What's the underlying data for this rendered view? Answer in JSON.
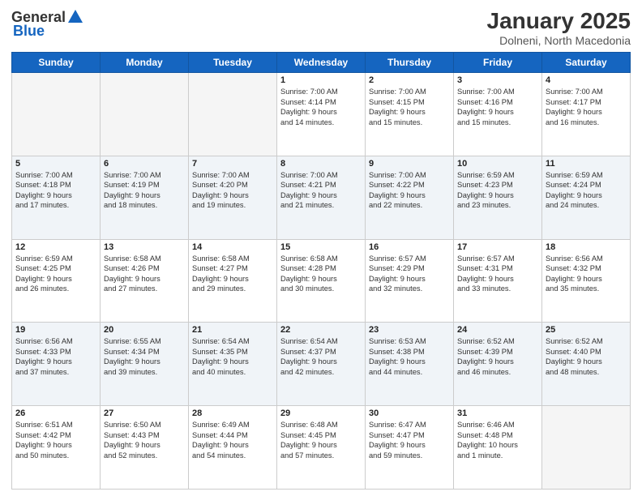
{
  "header": {
    "logo_general": "General",
    "logo_blue": "Blue",
    "month_year": "January 2025",
    "location": "Dolneni, North Macedonia"
  },
  "days_of_week": [
    "Sunday",
    "Monday",
    "Tuesday",
    "Wednesday",
    "Thursday",
    "Friday",
    "Saturday"
  ],
  "weeks": [
    {
      "shaded": false,
      "days": [
        {
          "num": "",
          "info": ""
        },
        {
          "num": "",
          "info": ""
        },
        {
          "num": "",
          "info": ""
        },
        {
          "num": "1",
          "info": "Sunrise: 7:00 AM\nSunset: 4:14 PM\nDaylight: 9 hours\nand 14 minutes."
        },
        {
          "num": "2",
          "info": "Sunrise: 7:00 AM\nSunset: 4:15 PM\nDaylight: 9 hours\nand 15 minutes."
        },
        {
          "num": "3",
          "info": "Sunrise: 7:00 AM\nSunset: 4:16 PM\nDaylight: 9 hours\nand 15 minutes."
        },
        {
          "num": "4",
          "info": "Sunrise: 7:00 AM\nSunset: 4:17 PM\nDaylight: 9 hours\nand 16 minutes."
        }
      ]
    },
    {
      "shaded": true,
      "days": [
        {
          "num": "5",
          "info": "Sunrise: 7:00 AM\nSunset: 4:18 PM\nDaylight: 9 hours\nand 17 minutes."
        },
        {
          "num": "6",
          "info": "Sunrise: 7:00 AM\nSunset: 4:19 PM\nDaylight: 9 hours\nand 18 minutes."
        },
        {
          "num": "7",
          "info": "Sunrise: 7:00 AM\nSunset: 4:20 PM\nDaylight: 9 hours\nand 19 minutes."
        },
        {
          "num": "8",
          "info": "Sunrise: 7:00 AM\nSunset: 4:21 PM\nDaylight: 9 hours\nand 21 minutes."
        },
        {
          "num": "9",
          "info": "Sunrise: 7:00 AM\nSunset: 4:22 PM\nDaylight: 9 hours\nand 22 minutes."
        },
        {
          "num": "10",
          "info": "Sunrise: 6:59 AM\nSunset: 4:23 PM\nDaylight: 9 hours\nand 23 minutes."
        },
        {
          "num": "11",
          "info": "Sunrise: 6:59 AM\nSunset: 4:24 PM\nDaylight: 9 hours\nand 24 minutes."
        }
      ]
    },
    {
      "shaded": false,
      "days": [
        {
          "num": "12",
          "info": "Sunrise: 6:59 AM\nSunset: 4:25 PM\nDaylight: 9 hours\nand 26 minutes."
        },
        {
          "num": "13",
          "info": "Sunrise: 6:58 AM\nSunset: 4:26 PM\nDaylight: 9 hours\nand 27 minutes."
        },
        {
          "num": "14",
          "info": "Sunrise: 6:58 AM\nSunset: 4:27 PM\nDaylight: 9 hours\nand 29 minutes."
        },
        {
          "num": "15",
          "info": "Sunrise: 6:58 AM\nSunset: 4:28 PM\nDaylight: 9 hours\nand 30 minutes."
        },
        {
          "num": "16",
          "info": "Sunrise: 6:57 AM\nSunset: 4:29 PM\nDaylight: 9 hours\nand 32 minutes."
        },
        {
          "num": "17",
          "info": "Sunrise: 6:57 AM\nSunset: 4:31 PM\nDaylight: 9 hours\nand 33 minutes."
        },
        {
          "num": "18",
          "info": "Sunrise: 6:56 AM\nSunset: 4:32 PM\nDaylight: 9 hours\nand 35 minutes."
        }
      ]
    },
    {
      "shaded": true,
      "days": [
        {
          "num": "19",
          "info": "Sunrise: 6:56 AM\nSunset: 4:33 PM\nDaylight: 9 hours\nand 37 minutes."
        },
        {
          "num": "20",
          "info": "Sunrise: 6:55 AM\nSunset: 4:34 PM\nDaylight: 9 hours\nand 39 minutes."
        },
        {
          "num": "21",
          "info": "Sunrise: 6:54 AM\nSunset: 4:35 PM\nDaylight: 9 hours\nand 40 minutes."
        },
        {
          "num": "22",
          "info": "Sunrise: 6:54 AM\nSunset: 4:37 PM\nDaylight: 9 hours\nand 42 minutes."
        },
        {
          "num": "23",
          "info": "Sunrise: 6:53 AM\nSunset: 4:38 PM\nDaylight: 9 hours\nand 44 minutes."
        },
        {
          "num": "24",
          "info": "Sunrise: 6:52 AM\nSunset: 4:39 PM\nDaylight: 9 hours\nand 46 minutes."
        },
        {
          "num": "25",
          "info": "Sunrise: 6:52 AM\nSunset: 4:40 PM\nDaylight: 9 hours\nand 48 minutes."
        }
      ]
    },
    {
      "shaded": false,
      "days": [
        {
          "num": "26",
          "info": "Sunrise: 6:51 AM\nSunset: 4:42 PM\nDaylight: 9 hours\nand 50 minutes."
        },
        {
          "num": "27",
          "info": "Sunrise: 6:50 AM\nSunset: 4:43 PM\nDaylight: 9 hours\nand 52 minutes."
        },
        {
          "num": "28",
          "info": "Sunrise: 6:49 AM\nSunset: 4:44 PM\nDaylight: 9 hours\nand 54 minutes."
        },
        {
          "num": "29",
          "info": "Sunrise: 6:48 AM\nSunset: 4:45 PM\nDaylight: 9 hours\nand 57 minutes."
        },
        {
          "num": "30",
          "info": "Sunrise: 6:47 AM\nSunset: 4:47 PM\nDaylight: 9 hours\nand 59 minutes."
        },
        {
          "num": "31",
          "info": "Sunrise: 6:46 AM\nSunset: 4:48 PM\nDaylight: 10 hours\nand 1 minute."
        },
        {
          "num": "",
          "info": ""
        }
      ]
    }
  ]
}
